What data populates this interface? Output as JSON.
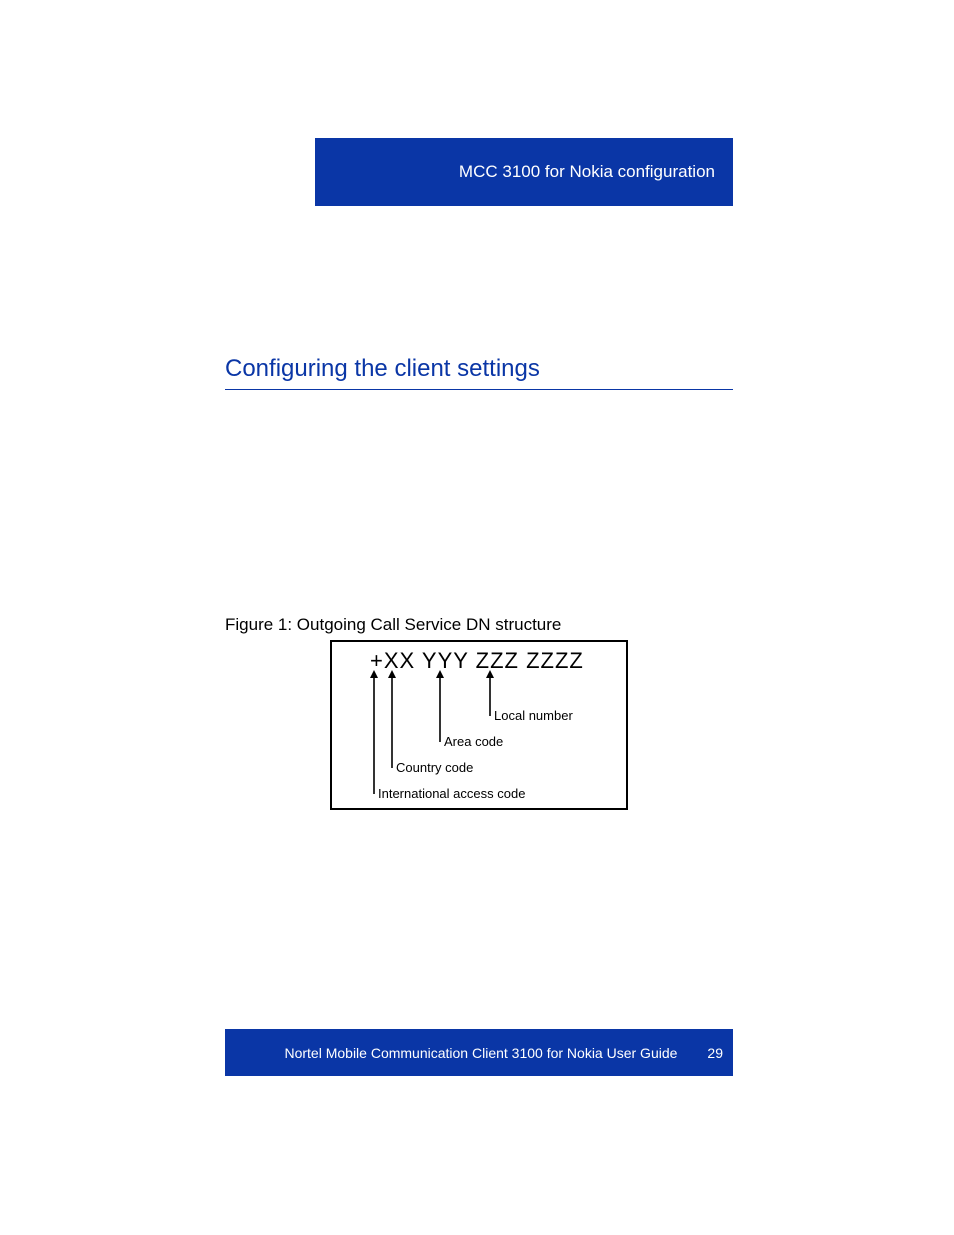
{
  "header": {
    "section": "MCC 3100 for Nokia configuration"
  },
  "heading": "Configuring the client settings",
  "figure": {
    "caption": "Figure 1: Outgoing Call Service DN structure",
    "dn_format": "+XX YYY ZZZ ZZZZ",
    "labels": {
      "local": "Local number",
      "area": "Area code",
      "country": "Country code",
      "intl": "International access code"
    }
  },
  "footer": {
    "title": "Nortel Mobile Communication Client 3100 for Nokia User Guide",
    "page": "29"
  }
}
